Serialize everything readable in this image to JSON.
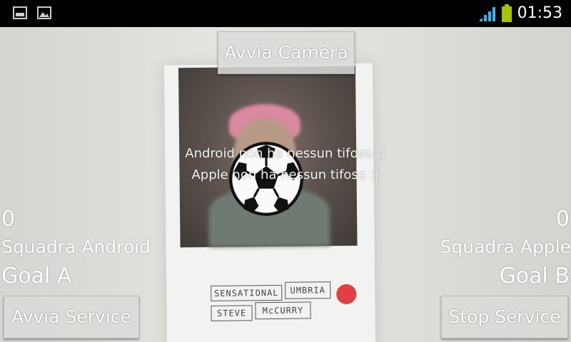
{
  "status_bar": {
    "time": "01:53",
    "icons": [
      "sd-card-icon",
      "image-icon",
      "signal-icon",
      "battery-icon"
    ],
    "battery_color": "#a4c400",
    "signal_color": "#33b5e5"
  },
  "buttons": {
    "start_camera": "Avvia Camera",
    "start_service": "Avvia Service",
    "stop_service": "Stop Service"
  },
  "messages": {
    "android": "Android non ha nessun tifoso :(",
    "apple": "Apple non ha nessun tifoso :("
  },
  "team_left": {
    "score": "0",
    "name": "Squadra Android",
    "goal": "Goal A"
  },
  "team_right": {
    "score": "0",
    "name": "Squadra Apple",
    "goal": "Goal B"
  },
  "camera_preview": {
    "card_text": [
      "SENSATIONAL",
      "UMBRIA",
      "STEVE",
      "McCURRY"
    ]
  }
}
